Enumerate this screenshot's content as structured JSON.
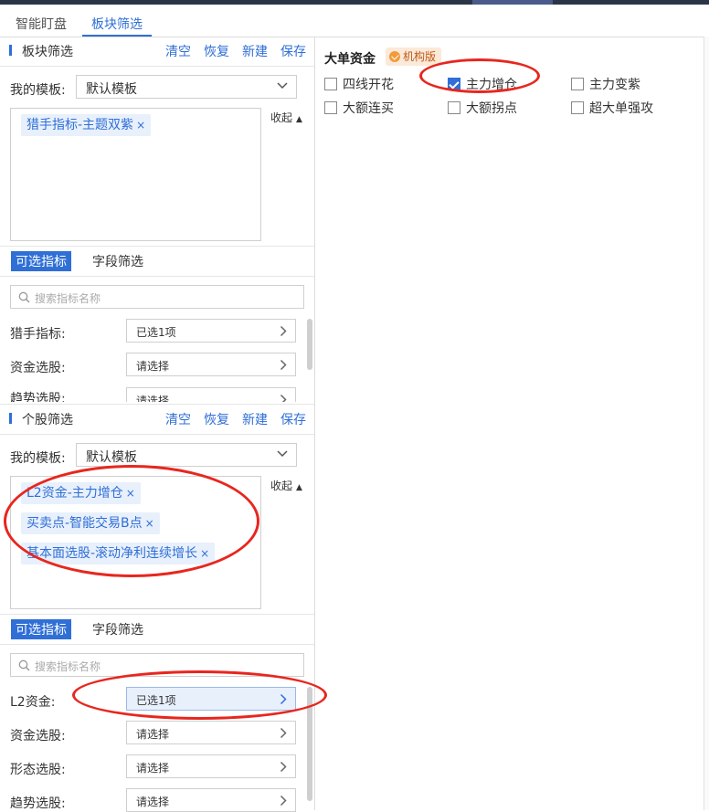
{
  "tabs": [
    {
      "label": "智能盯盘"
    },
    {
      "label": "板块筛选"
    }
  ],
  "sector_panel": {
    "title": "板块筛选",
    "actions": {
      "clear": "清空",
      "restore": "恢复",
      "new": "新建",
      "save": "保存"
    },
    "template_label": "我的模板:",
    "template_value": "默认模板",
    "tags": [
      "猎手指标-主题双紫"
    ],
    "collapse_label": "收起",
    "sub_tabs": {
      "indicators": "可选指标",
      "fields": "字段筛选"
    },
    "search_placeholder": "搜索指标名称",
    "filters": [
      {
        "label": "猎手指标:",
        "value": "已选1项"
      },
      {
        "label": "资金选股:",
        "value": "请选择"
      },
      {
        "label": "趋势选股:",
        "value": "请选择"
      }
    ]
  },
  "stock_panel": {
    "title": "个股筛选",
    "actions": {
      "clear": "清空",
      "restore": "恢复",
      "new": "新建",
      "save": "保存"
    },
    "template_label": "我的模板:",
    "template_value": "默认模板",
    "tags": [
      "L2资金-主力增仓",
      "买卖点-智能交易B点",
      "基本面选股-滚动净利连续增长"
    ],
    "collapse_label": "收起",
    "sub_tabs": {
      "indicators": "可选指标",
      "fields": "字段筛选"
    },
    "search_placeholder": "搜索指标名称",
    "filters": [
      {
        "label": "L2资金:",
        "value": "已选1项"
      },
      {
        "label": "资金选股:",
        "value": "请选择"
      },
      {
        "label": "形态选股:",
        "value": "请选择"
      },
      {
        "label": "趋势选股:",
        "value": "请选择"
      }
    ]
  },
  "big_order": {
    "title": "大单资金",
    "badge": "机构版",
    "options": [
      {
        "label": "四线开花",
        "checked": false
      },
      {
        "label": "主力增仓",
        "checked": true
      },
      {
        "label": "主力变紫",
        "checked": false
      },
      {
        "label": "大额连买",
        "checked": false
      },
      {
        "label": "大额拐点",
        "checked": false
      },
      {
        "label": "超大单强攻",
        "checked": false
      }
    ]
  },
  "colors": {
    "accent": "#2f6fd6",
    "annotation": "#e8261e",
    "tag_bg": "#e8f0fc",
    "badge_bg": "#fbe9d9"
  }
}
